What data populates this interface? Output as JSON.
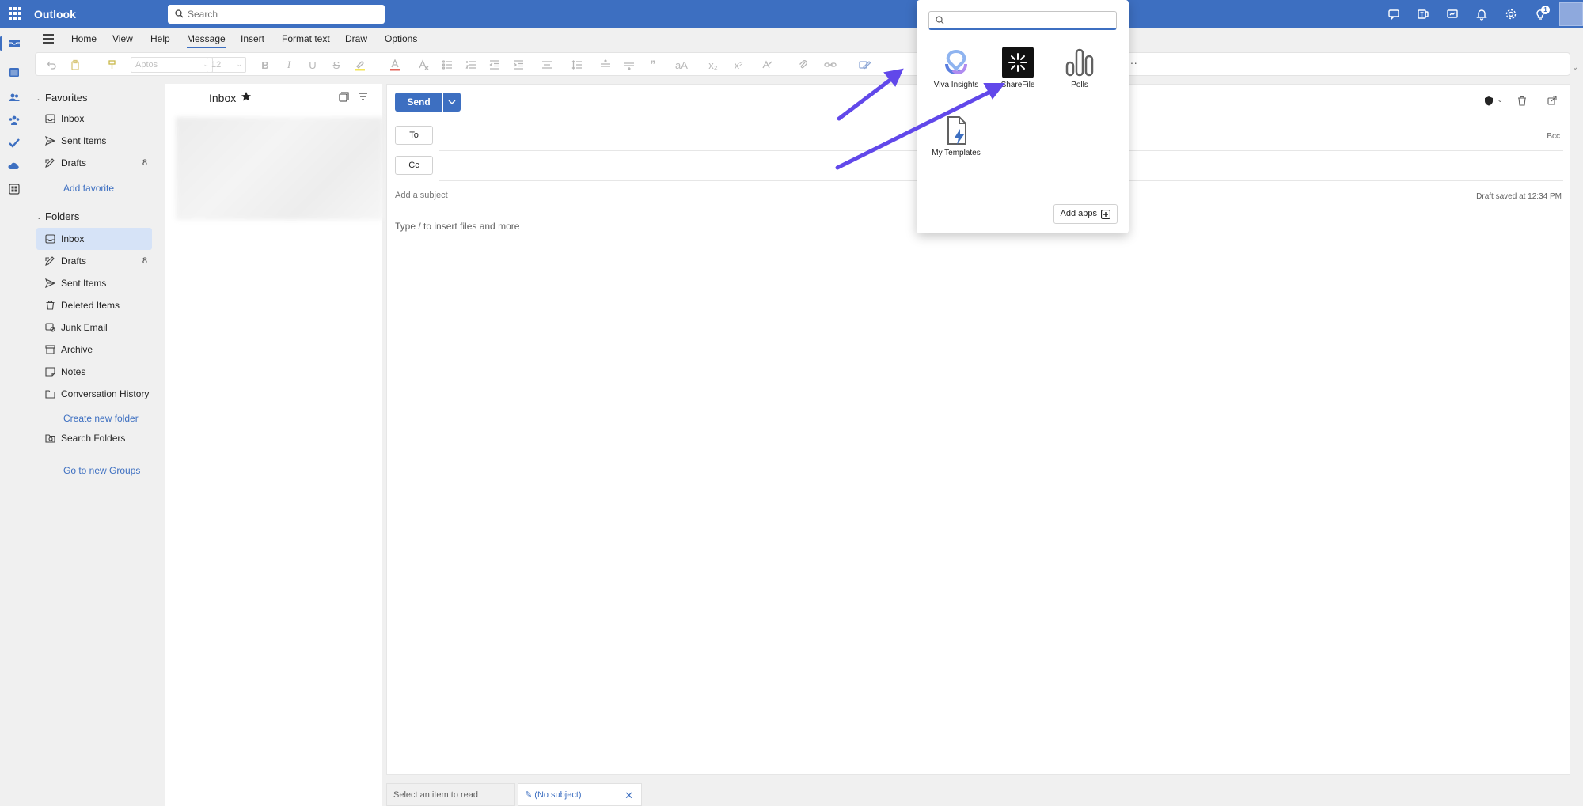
{
  "app": {
    "name": "Outlook"
  },
  "search": {
    "placeholder": "Search"
  },
  "ribbon": {
    "tabs": [
      "Home",
      "View",
      "Help",
      "Message",
      "Insert",
      "Format text",
      "Draw",
      "Options"
    ],
    "active_tab": "Message",
    "font_name": "Aptos",
    "font_size": "12",
    "more": "···"
  },
  "top_icons": [
    "chat-icon",
    "teams-icon",
    "whiteboard-icon",
    "bell-icon",
    "gear-icon",
    "lightbulb-icon"
  ],
  "top_badge": "1",
  "folders": {
    "favorites_label": "Favorites",
    "favorites": [
      {
        "label": "Inbox",
        "icon": "inbox-icon",
        "count": ""
      },
      {
        "label": "Sent Items",
        "icon": "send-icon",
        "count": ""
      },
      {
        "label": "Drafts",
        "icon": "pencil-icon",
        "count": "8"
      }
    ],
    "add_favorite": "Add favorite",
    "folders_label": "Folders",
    "items": [
      {
        "label": "Inbox",
        "icon": "inbox-icon",
        "count": ""
      },
      {
        "label": "Drafts",
        "icon": "pencil-icon",
        "count": "8"
      },
      {
        "label": "Sent Items",
        "icon": "send-icon",
        "count": ""
      },
      {
        "label": "Deleted Items",
        "icon": "trash-icon",
        "count": ""
      },
      {
        "label": "Junk Email",
        "icon": "junk-icon",
        "count": ""
      },
      {
        "label": "Archive",
        "icon": "archive-icon",
        "count": ""
      },
      {
        "label": "Notes",
        "icon": "note-icon",
        "count": ""
      },
      {
        "label": "Conversation History",
        "icon": "folder-icon",
        "count": ""
      }
    ],
    "create_new_folder": "Create new folder",
    "search_folders": "Search Folders",
    "go_to_groups": "Go to new Groups"
  },
  "message_list": {
    "title": "Inbox"
  },
  "compose": {
    "send": "Send",
    "to": "To",
    "cc": "Cc",
    "bcc": "Bcc",
    "subject_placeholder": "Add a subject",
    "draft_saved": "Draft saved at 12:34 PM",
    "body_placeholder": "Type / to insert files and more"
  },
  "bottom_tabs": {
    "select_item": "Select an item to read",
    "no_subject": "(No subject)"
  },
  "apps_popup": {
    "apps": [
      {
        "label": "Viva Insights",
        "icon": "viva-insights-icon"
      },
      {
        "label": "ShareFile",
        "icon": "sharefile-icon"
      },
      {
        "label": "Polls",
        "icon": "polls-icon"
      },
      {
        "label": "My Templates",
        "icon": "my-templates-icon"
      }
    ],
    "add_apps": "Add apps"
  },
  "colors": {
    "brand": "#3d6fc1",
    "annotation": "#6148ea",
    "selected": "#d6e3f7"
  }
}
